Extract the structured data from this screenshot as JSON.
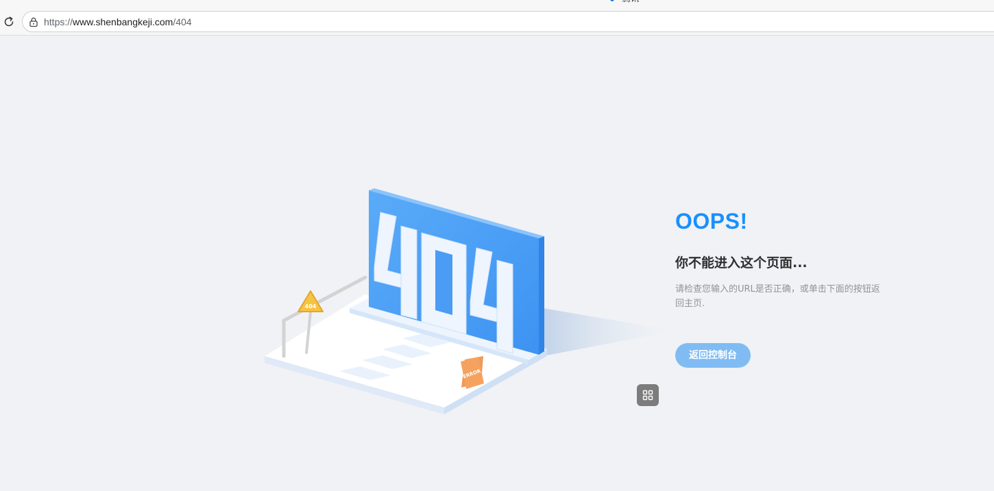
{
  "browser": {
    "tab_title": "腾讯",
    "url_scheme": "https://",
    "url_host": "www.shenbangkeji.com",
    "url_path": "/404"
  },
  "illustration": {
    "screen_text": "404",
    "sign_text": "404",
    "board_text": "ERROR"
  },
  "error": {
    "title": "OOPS!",
    "headline": "你不能进入这个页面...",
    "description": "请检查您输入的URL是否正确，或单击下面的按钮返回主页.",
    "button_label": "返回控制台"
  },
  "colors": {
    "accent": "#1890ff",
    "button": "#80bcf3",
    "background": "#f0f2f5"
  },
  "icons": [
    "reload-icon",
    "lock-icon",
    "grid-icon"
  ]
}
